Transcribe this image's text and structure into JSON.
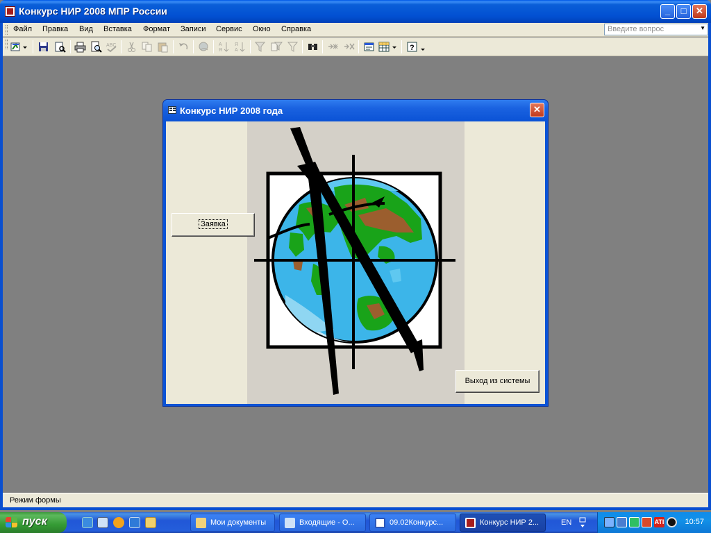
{
  "app": {
    "title": "Конкурс НИР 2008 МПР России",
    "minimize": "_",
    "maximize": "□",
    "close": "✕"
  },
  "menu": {
    "items": [
      "Файл",
      "Правка",
      "Вид",
      "Вставка",
      "Формат",
      "Записи",
      "Сервис",
      "Окно",
      "Справка"
    ],
    "ask_placeholder": "Введите вопрос"
  },
  "toolbar": {
    "icons": [
      "view-icon",
      "save-icon",
      "file-search-icon",
      "print-icon",
      "print-preview-icon",
      "spelling-icon",
      "cut-icon",
      "copy-icon",
      "paste-icon",
      "undo-icon",
      "hyperlink-icon",
      "sort-ascending-icon",
      "sort-descending-icon",
      "filter-by-selection-icon",
      "filter-by-form-icon",
      "apply-filter-icon",
      "find-icon",
      "new-record-icon",
      "delete-record-icon",
      "properties-icon",
      "database-window-icon",
      "new-object-icon",
      "help-icon"
    ]
  },
  "form": {
    "title": "Конкурс НИР  2008 года",
    "close": "✕",
    "buttons": {
      "application": "Заявка",
      "exit": "Выход из системы"
    }
  },
  "status": {
    "text": "Режим формы"
  },
  "taskbar": {
    "start": "пуск",
    "tasks": [
      {
        "label": "Мои документы",
        "active": false
      },
      {
        "label": "Входящие - О...",
        "active": false
      },
      {
        "label": "09.02Конкурс...",
        "active": false
      },
      {
        "label": "Конкурс НИР 2...",
        "active": true
      }
    ],
    "language": "EN",
    "time": "10:57"
  },
  "colors": {
    "xp_blue": "#0b53d6",
    "face": "#ece9d8",
    "workspace": "#808080",
    "start_green": "#3c9a3c",
    "close_red": "#c0391b"
  }
}
